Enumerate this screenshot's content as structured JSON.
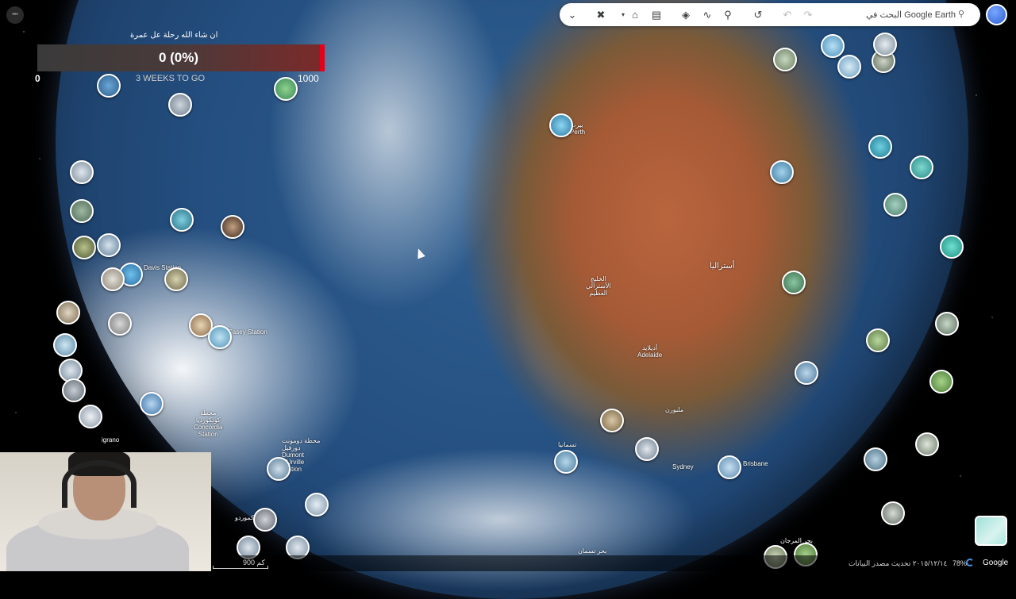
{
  "progress": {
    "title": "ان شاء الله رحلة عل عمرة",
    "value_text": "0 (0%)",
    "fraction": 0,
    "min_label": "0",
    "max_label": "1000",
    "subtitle": "3 WEEKS TO GO"
  },
  "toolbar": {
    "icons": [
      "chevron-down-icon",
      "tools-icon",
      "dropdown-small-icon",
      "home-icon",
      "ruler-icon",
      "layers-icon",
      "path-icon",
      "placemark-icon",
      "history-icon",
      "undo-icon",
      "redo-icon"
    ],
    "search_placeholder": "البحث في Google Earth",
    "corner_label": "•••"
  },
  "map": {
    "labels": {
      "perth": "بيرث\nPerth",
      "davis": "Davis Station",
      "casey": "Casey Station",
      "concordia": "محطة\nكونكورديا\nConcordia\nStation",
      "dumont": "محطة دومونت\nدورفيل\nDumont\nd'Urville\nStation",
      "australia": "أستراليا",
      "bight": "الخليج\nالأسترالي\nالعظيم",
      "adelaide": "أديلايد\nAdelaide",
      "melbourne": "ملبورن",
      "sydney": "Sydney",
      "brisbane": "Brisbane",
      "tasmania": "تسمانيا",
      "nigrano": "igrano",
      "mcmurdo": "ماكموردو",
      "coral": "بحر المرجان",
      "tasman": "بحر تسمان"
    }
  },
  "footer": {
    "scale": "900 كم",
    "date": "٢٠١٥/١٢/١٤ تحديث مصدر البيانات",
    "zoom": "78%",
    "google": "Google"
  },
  "colors": {
    "accent": "#e2001a",
    "toolbar_bg": "#ffffff"
  }
}
